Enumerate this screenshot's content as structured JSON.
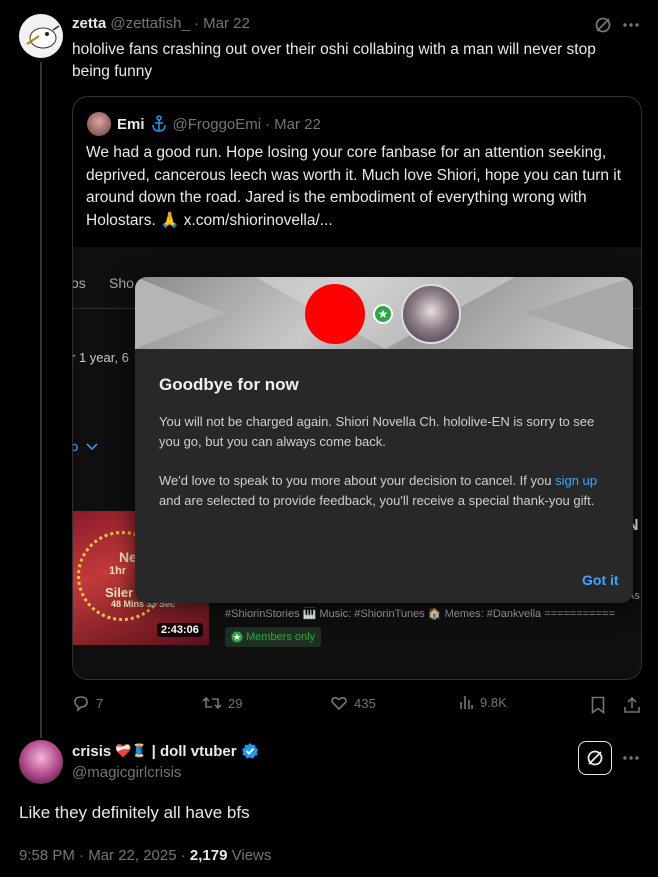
{
  "post": {
    "display_name": "zetta",
    "handle": "@zettafish_",
    "separator": "·",
    "date": "Mar 22",
    "text": "hololive fans crashing out over their oshi collabing with a man will never stop being funny"
  },
  "quote": {
    "display_name": "Emi",
    "handle": "@FroggoEmi",
    "separator": "·",
    "date": "Mar 22",
    "text": "We had a good run. Hope losing your core fanbase for an attention seeking, deprived, cancerous leech was worth it. Much love Shiori, hope you can turn it around down the road. Jared is the embodiment of everything wrong with Holostars. 🙏 ",
    "link": "x.com/shiorinovella/...",
    "screenshot": {
      "tab_partial_1": "os",
      "tab_partial_2": "Sho",
      "membership_partial": "r 1 year, 6",
      "filter_partial": "o",
      "thumb_text_1": "Ne",
      "thumb_text_2": "1hr",
      "thumb_text_3": "Siler",
      "thumb_text_4": "48 Mins 33 Sec",
      "thumb_duration": "2:43:06",
      "title_partial": "N",
      "desc_partial": "As",
      "hashtags": "#ShiorinStories 🎹 Music: #ShiorinTunes 🏠 Memes: #Dankvella ===========",
      "members_badge": "Members only",
      "dialog": {
        "title": "Goodbye for now",
        "body1": "You will not be charged again. Shiori Novella Ch. hololive-EN is sorry to see you go, but you can always come back.",
        "body2_pre": "We'd love to speak to you more about your decision to cancel. If you ",
        "body2_link": "sign up",
        "body2_post": " and are selected to provide feedback, you'll receive a special thank-you gift.",
        "button": "Got it"
      }
    }
  },
  "actions": {
    "replies": "7",
    "reposts": "29",
    "likes": "435",
    "views": "9.8K"
  },
  "reply": {
    "display_name": "crisis",
    "name_emoji": "❤️‍🩹🧵",
    "name_suffix": "| doll vtuber",
    "handle": "@magicgirlcrisis",
    "text": "Like they definitely all have bfs",
    "time": "9:58 PM · Mar 22, 2025 · ",
    "views_count": "2,179",
    "views_label": " Views"
  },
  "colors": {
    "background": "#000000",
    "text": "#e7e9ea",
    "muted": "#71767b",
    "link": "#1d9bf0",
    "verified": "#1d9bf0",
    "dialog_bg": "#282828",
    "dialog_link": "#3ea6ff",
    "red_circle": "#ff0000",
    "members_green": "#2ba640"
  },
  "icons": [
    "grok-icon",
    "more-icon",
    "anchor-icon",
    "reply-icon",
    "repost-icon",
    "like-icon",
    "views-icon",
    "bookmark-icon",
    "share-icon",
    "verified-icon",
    "chevron-down-icon",
    "star-badge-icon"
  ]
}
